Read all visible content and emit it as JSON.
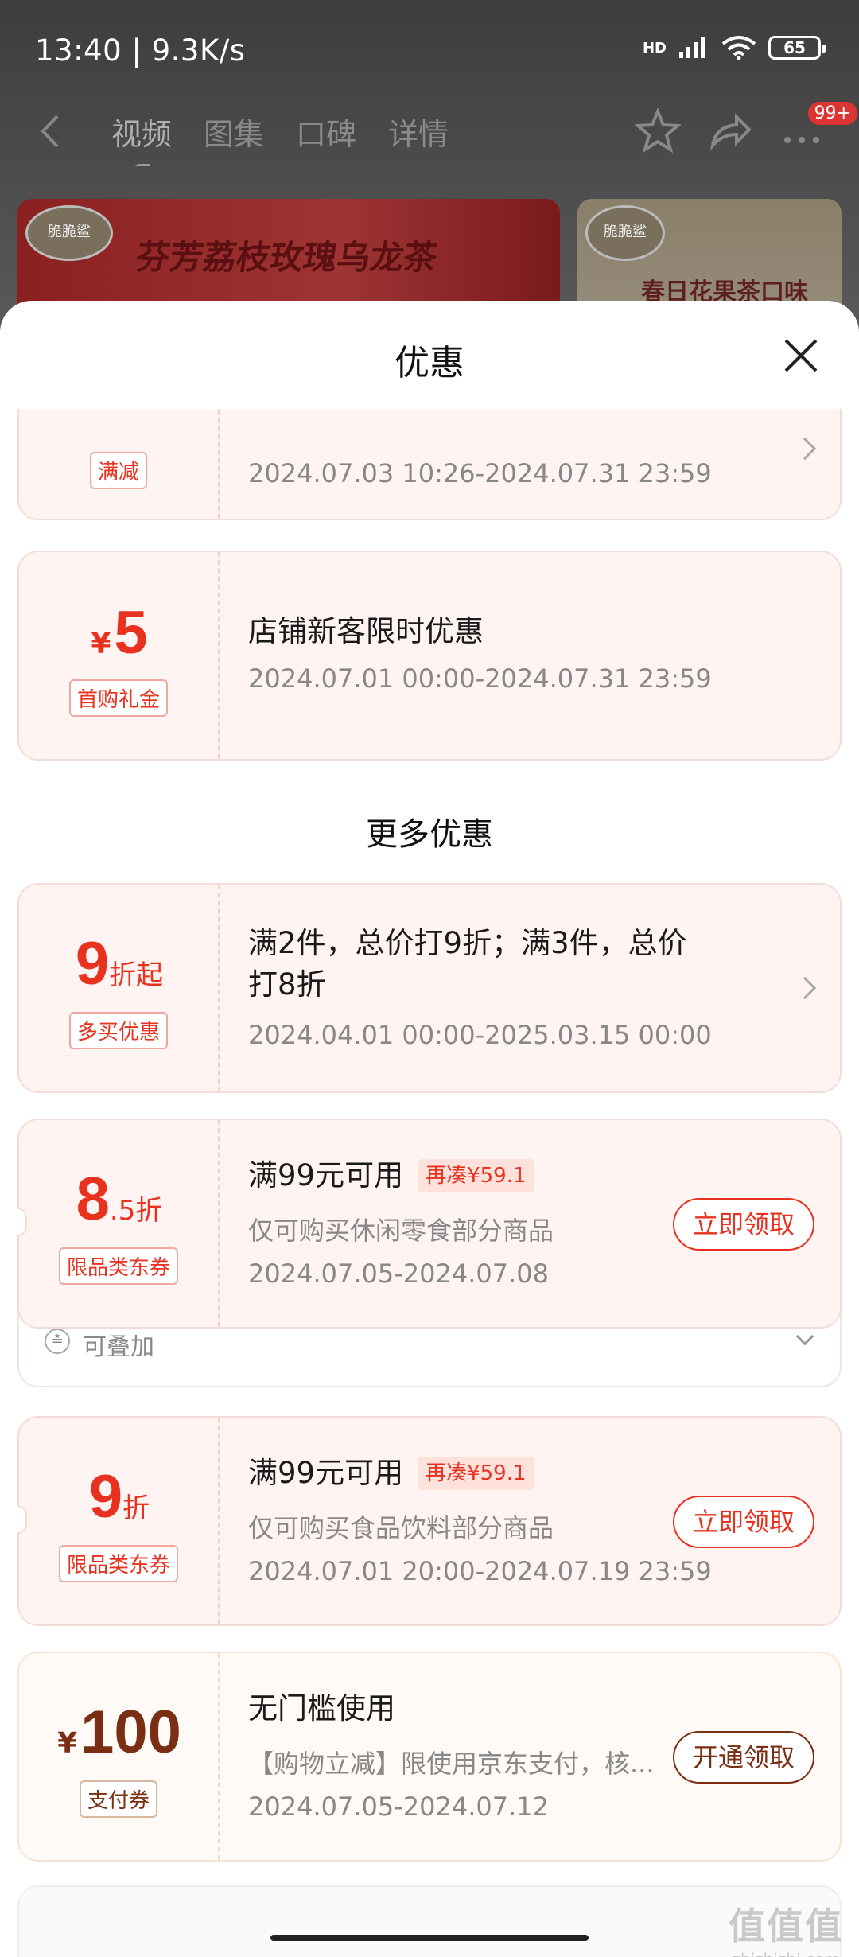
{
  "status_bar": {
    "time": "13:40 | 9.3K/s",
    "battery": "65",
    "network": "HD"
  },
  "nav": {
    "tabs": [
      "视频",
      "图集",
      "口碑",
      "详情"
    ],
    "active_tab": "视频",
    "badge": "99+"
  },
  "banners": {
    "banner1_brand": "脆脆鲨",
    "banner1_text": "芬芳荔枝玫瑰乌龙茶",
    "banner2_brand": "脆脆鲨",
    "banner2_text": "春日花果茶口味"
  },
  "sheet": {
    "title": "优惠"
  },
  "coupons": [
    {
      "tag": "满减",
      "date": "2024.07.03 10:26-2024.07.31 23:59"
    },
    {
      "value_prefix": "¥",
      "value": "5",
      "tag": "首购礼金",
      "title": "店铺新客限时优惠",
      "date": "2024.07.01 00:00-2024.07.31 23:59"
    }
  ],
  "more_section_title": "更多优惠",
  "more_coupons": [
    {
      "value": "9",
      "value_suffix": "折起",
      "tag": "多买优惠",
      "title_line1": "满2件，总价打9折；满3件，总价",
      "title_line2": "打8折",
      "date": "2024.04.01 00:00-2025.03.15 00:00"
    },
    {
      "value": "8",
      "value_suffix": ".5折",
      "tag": "限品类东券",
      "title": "满99元可用",
      "extra": "再凑¥59.1",
      "desc": "仅可购买休闲零食部分商品",
      "date": "2024.07.05-2024.07.08",
      "button": "立即领取",
      "stack_label": "可叠加"
    },
    {
      "value": "9",
      "value_suffix": "折",
      "tag": "限品类东券",
      "title": "满99元可用",
      "extra": "再凑¥59.1",
      "desc": "仅可购买食品饮料部分商品",
      "date": "2024.07.01 20:00-2024.07.19 23:59",
      "button": "立即领取"
    },
    {
      "value_prefix": "¥",
      "value": "100",
      "tag": "支付券",
      "title": "无门槛使用",
      "desc": "【购物立减】限使用京东支付，核...",
      "date": "2024.07.05-2024.07.12",
      "button": "开通领取"
    }
  ],
  "watermark": {
    "big": "值值值",
    "small": "zhizhizhi.com"
  },
  "colors": {
    "accent": "#e8321f",
    "gold": "#7a2e14",
    "coupon_bg": "#fff4f2"
  }
}
